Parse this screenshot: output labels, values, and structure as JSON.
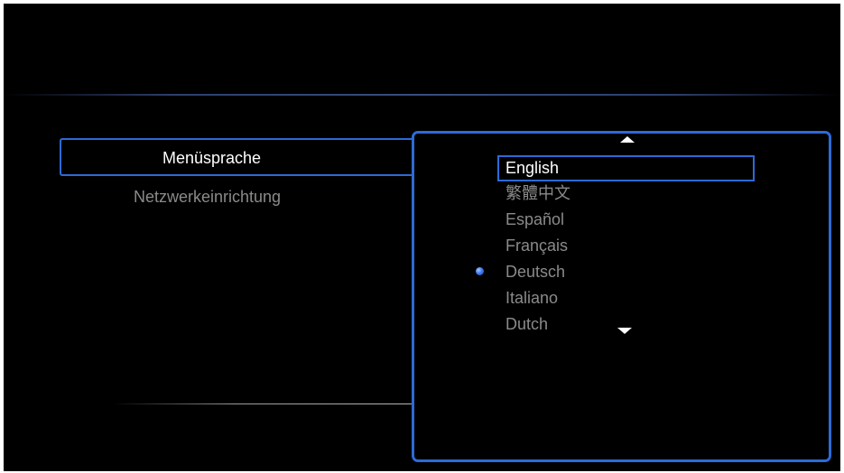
{
  "settings_menu": {
    "items": [
      {
        "label": "Menüsprache",
        "selected": true
      },
      {
        "label": "Netzwerkeinrichtung",
        "selected": false
      }
    ]
  },
  "language_list": {
    "scroll_up_icon": "triangle-up",
    "scroll_down_icon": "triangle-down",
    "focused_index": 0,
    "active_index": 4,
    "options": [
      {
        "label": "English"
      },
      {
        "label": "繁體中文"
      },
      {
        "label": "Español"
      },
      {
        "label": "Français"
      },
      {
        "label": "Deutsch"
      },
      {
        "label": "Italiano"
      },
      {
        "label": "Dutch"
      }
    ]
  },
  "colors": {
    "background": "#000000",
    "highlight_border": "#2d6ad6",
    "selected_text": "#ffffff",
    "unselected_text": "#8a8a8a",
    "active_indicator": "#3f7bf0"
  }
}
